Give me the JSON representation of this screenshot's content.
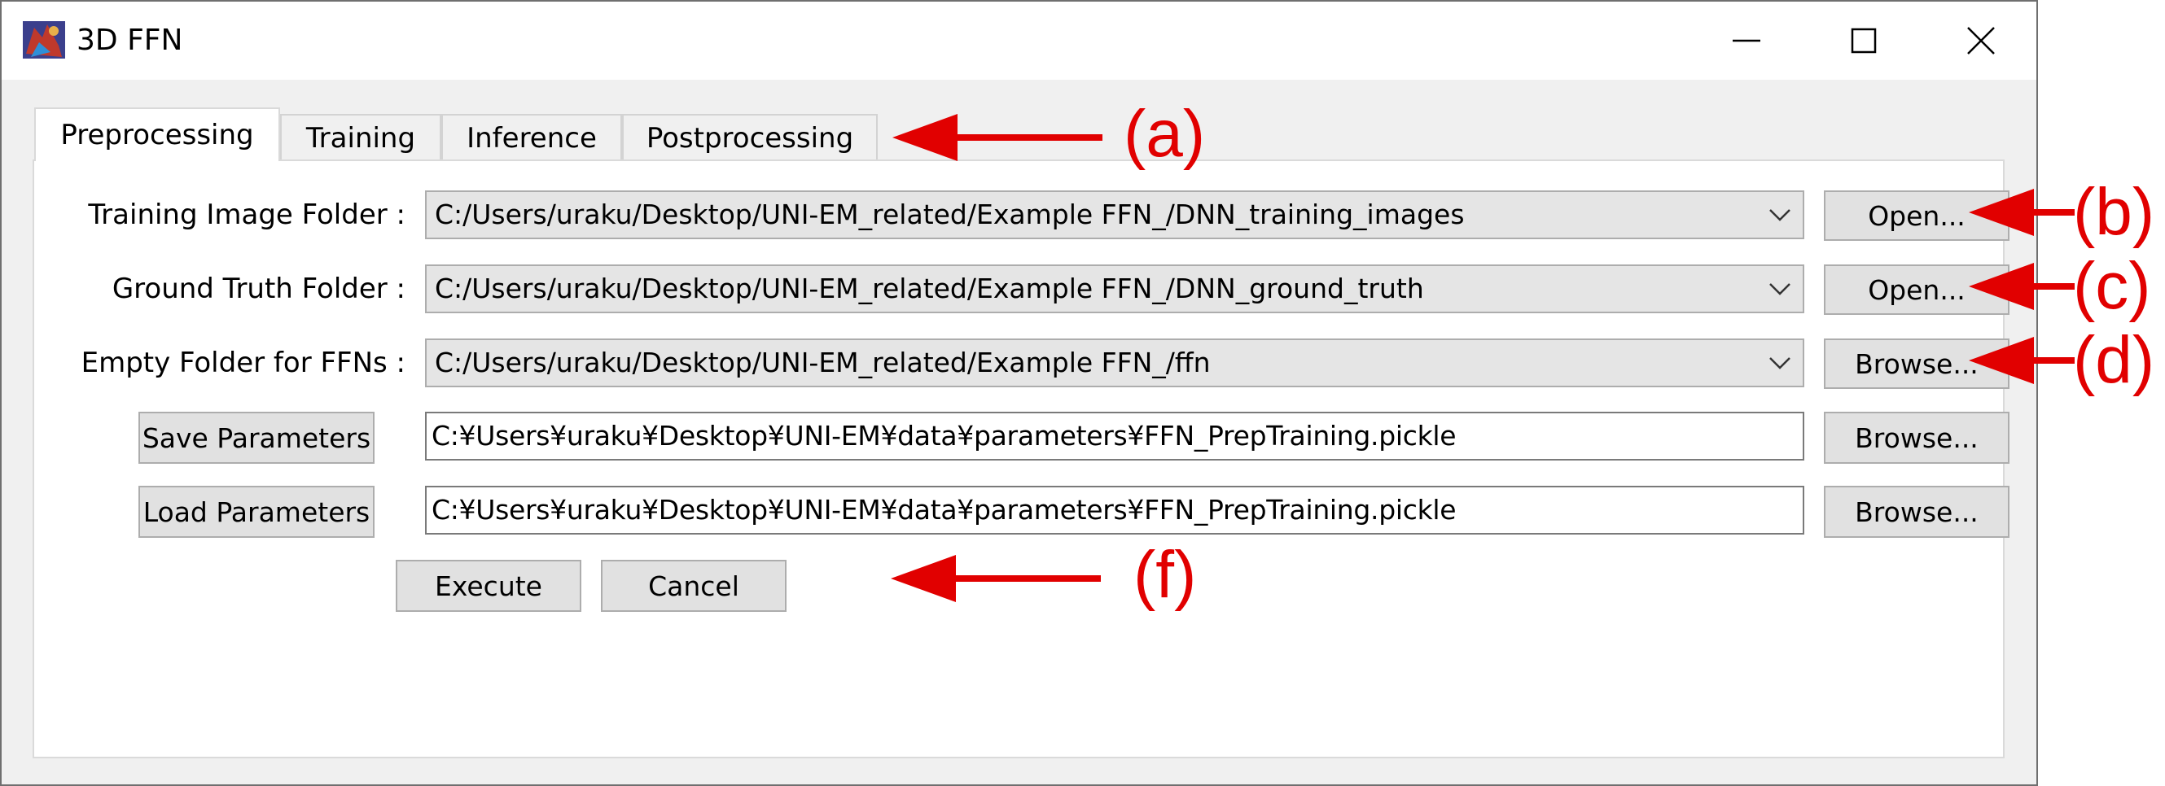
{
  "window": {
    "title": "3D FFN"
  },
  "tabs": [
    {
      "label": "Preprocessing",
      "active": true
    },
    {
      "label": "Training",
      "active": false
    },
    {
      "label": "Inference",
      "active": false
    },
    {
      "label": "Postprocessing",
      "active": false
    }
  ],
  "form": {
    "training_image_folder": {
      "label": "Training Image Folder :",
      "value": "C:/Users/uraku/Desktop/UNI-EM_related/Example FFN_/DNN_training_images",
      "button": "Open..."
    },
    "ground_truth_folder": {
      "label": "Ground Truth Folder :",
      "value": "C:/Users/uraku/Desktop/UNI-EM_related/Example FFN_/DNN_ground_truth",
      "button": "Open..."
    },
    "empty_folder": {
      "label": "Empty Folder for FFNs :",
      "value": "C:/Users/uraku/Desktop/UNI-EM_related/Example FFN_/ffn",
      "button": "Browse..."
    },
    "save_parameters": {
      "button": "Save Parameters",
      "value": "C:¥Users¥uraku¥Desktop¥UNI-EM¥data¥parameters¥FFN_PrepTraining.pickle",
      "browse": "Browse..."
    },
    "load_parameters": {
      "button": "Load Parameters",
      "value": "C:¥Users¥uraku¥Desktop¥UNI-EM¥data¥parameters¥FFN_PrepTraining.pickle",
      "browse": "Browse..."
    },
    "execute": "Execute",
    "cancel": "Cancel"
  },
  "annotations": {
    "a": "(a)",
    "b": "(b)",
    "c": "(c)",
    "d": "(d)",
    "f": "(f)"
  },
  "colors": {
    "annotation": "#e10000",
    "titlebar": "#ffffff",
    "window_bg": "#f0f0f0"
  },
  "icons": [
    "app-icon",
    "minimize-icon",
    "maximize-icon",
    "close-icon",
    "chevron-down-icon",
    "red-arrow-icon"
  ]
}
